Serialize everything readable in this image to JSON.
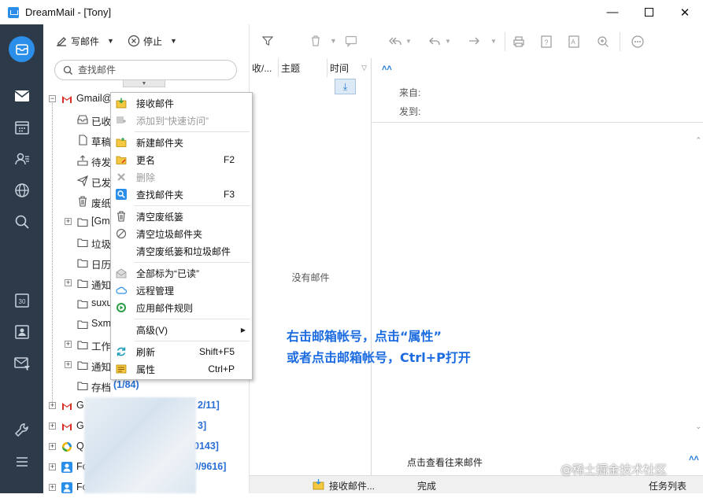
{
  "window": {
    "title": "DreamMail - [Tony]"
  },
  "toolbar": {
    "compose_label": "写邮件",
    "stop_label": "停止"
  },
  "search": {
    "placeholder": "查找邮件"
  },
  "tree": {
    "account_label": "Gmail@",
    "folders": [
      "已收",
      "草稿",
      "待发",
      "已发",
      "废纸",
      "[Gm",
      "垃圾",
      "日历",
      "通知",
      "suxu",
      "Sxm",
      "工作",
      "通知"
    ],
    "archive": {
      "label": "存档",
      "count": "(1/84)"
    },
    "other_accounts": [
      {
        "label": "G",
        "count": "2/11]"
      },
      {
        "label": "G",
        "count": "3]"
      },
      {
        "label": "Q",
        "count": "0143]"
      },
      {
        "label": "Fo",
        "count": "0/9616]"
      },
      {
        "label": "Fo",
        "count": ""
      }
    ]
  },
  "list": {
    "columns": [
      "收/...",
      "主题",
      "时间"
    ],
    "empty_text": "没有邮件"
  },
  "reader": {
    "from_label": "来自:",
    "to_label": "发到:",
    "view_history": "点击查看往来邮件"
  },
  "context_menu": {
    "items": [
      {
        "label": "接收邮件",
        "shortcut": "",
        "disabled": false
      },
      {
        "label": "添加到“快速访问”",
        "shortcut": "",
        "disabled": true
      },
      {
        "label": "新建邮件夹",
        "shortcut": "",
        "disabled": false
      },
      {
        "label": "更名",
        "shortcut": "F2",
        "disabled": false
      },
      {
        "label": "删除",
        "shortcut": "",
        "disabled": true
      },
      {
        "label": "查找邮件夹",
        "shortcut": "F3",
        "disabled": false
      },
      {
        "label": "清空废纸篓",
        "shortcut": "",
        "disabled": false
      },
      {
        "label": "清空垃圾邮件夹",
        "shortcut": "",
        "disabled": false
      },
      {
        "label": "清空废纸篓和垃圾邮件",
        "shortcut": "",
        "disabled": false
      },
      {
        "label": "全部标为“已读”",
        "shortcut": "",
        "disabled": false
      },
      {
        "label": "远程管理",
        "shortcut": "",
        "disabled": false
      },
      {
        "label": "应用邮件规则",
        "shortcut": "",
        "disabled": false
      },
      {
        "label": "高级(V)",
        "shortcut": "",
        "disabled": false
      },
      {
        "label": "刷新",
        "shortcut": "Shift+F5",
        "disabled": false
      },
      {
        "label": "属性",
        "shortcut": "Ctrl+P",
        "disabled": false
      }
    ]
  },
  "annotation": {
    "line1": "右击邮箱帐号，点击“属性”",
    "line2": "或者点击邮箱帐号，Ctrl+P打开"
  },
  "status": {
    "receiving": "接收邮件...",
    "done": "完成",
    "task_list": "任务列表"
  },
  "watermark": "@稀土掘金技术社区",
  "colors": {
    "rail": "#2c3a4a",
    "accent": "#2b8ee8",
    "annotation": "#1c6ce0"
  }
}
